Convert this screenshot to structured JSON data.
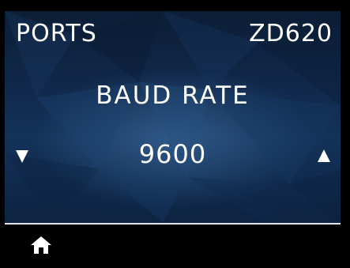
{
  "header": {
    "menu": "PORTS",
    "model": "ZD620"
  },
  "setting": {
    "title": "BAUD RATE",
    "value": "9600"
  },
  "controls": {
    "decrease_icon": "down-triangle-icon",
    "increase_icon": "up-triangle-icon",
    "home_icon": "home-icon"
  },
  "colors": {
    "background": "#000000",
    "panel_dark": "#0c1e36",
    "panel_mid": "#143259",
    "text": "#ffffff",
    "divider": "#e6e6e6"
  }
}
